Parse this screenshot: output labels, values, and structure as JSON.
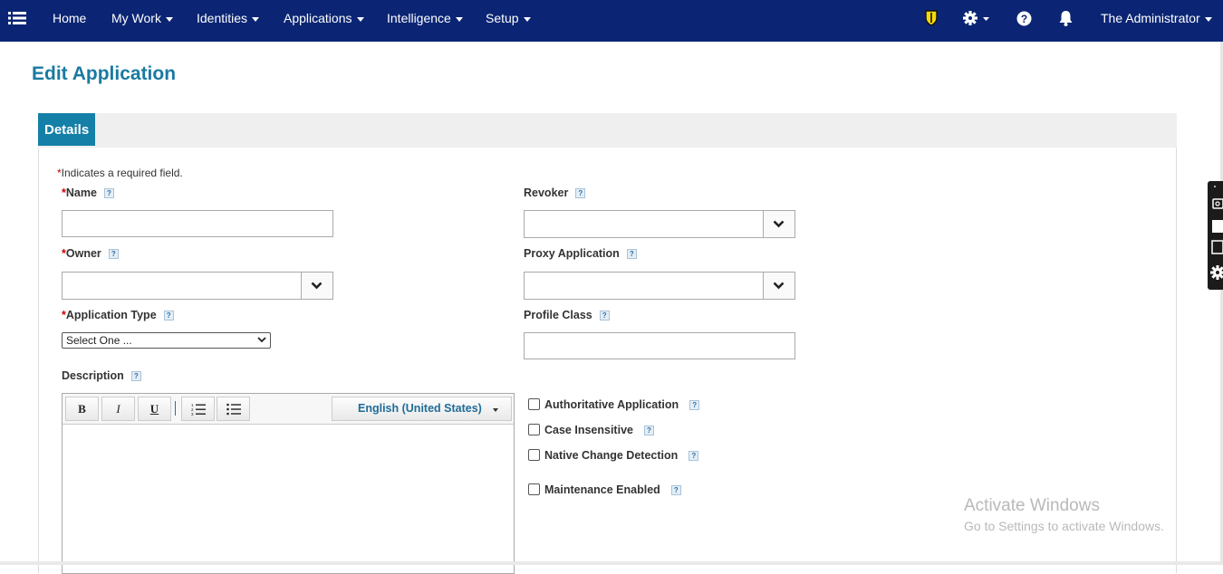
{
  "nav": {
    "items": [
      {
        "label": "Home",
        "has_dropdown": false
      },
      {
        "label": "My Work",
        "has_dropdown": true
      },
      {
        "label": "Identities",
        "has_dropdown": true
      },
      {
        "label": "Applications",
        "has_dropdown": true
      },
      {
        "label": "Intelligence",
        "has_dropdown": true
      },
      {
        "label": "Setup",
        "has_dropdown": true
      }
    ],
    "icons": [
      "menu-icon",
      "shield-icon",
      "gear-icon",
      "help-icon",
      "bell-icon"
    ],
    "user": "The Administrator",
    "color": "#0b2574",
    "shield_color": "#f5d90a"
  },
  "page": {
    "title": "Edit Application"
  },
  "tabs": [
    {
      "label": "Details",
      "active": true
    }
  ],
  "form": {
    "required_note_star": "*",
    "required_note": "Indicates a required field.",
    "help_glyph": "?",
    "fields": {
      "name": {
        "label": "Name",
        "required": true,
        "value": ""
      },
      "owner": {
        "label": "Owner",
        "required": true,
        "value": ""
      },
      "app_type": {
        "label": "Application Type",
        "required": true,
        "selected": "Select One ..."
      },
      "description": {
        "label": "Description",
        "required": false
      },
      "revoker": {
        "label": "Revoker",
        "value": ""
      },
      "proxy_application": {
        "label": "Proxy Application",
        "value": ""
      },
      "profile_class": {
        "label": "Profile Class",
        "value": ""
      }
    },
    "editor": {
      "bold": "B",
      "italic": "I",
      "underline": "U",
      "language": "English (United States)"
    },
    "checkboxes": [
      {
        "label": "Authoritative Application",
        "checked": false
      },
      {
        "label": "Case Insensitive",
        "checked": false
      },
      {
        "label": "Native Change Detection",
        "checked": false
      },
      {
        "label": "Maintenance Enabled",
        "checked": false
      }
    ]
  },
  "watermark": {
    "line1": "Activate Windows",
    "line2": "Go to Settings to activate Windows."
  },
  "colors": {
    "accent": "#1480a8",
    "title": "#1a7aa0"
  }
}
